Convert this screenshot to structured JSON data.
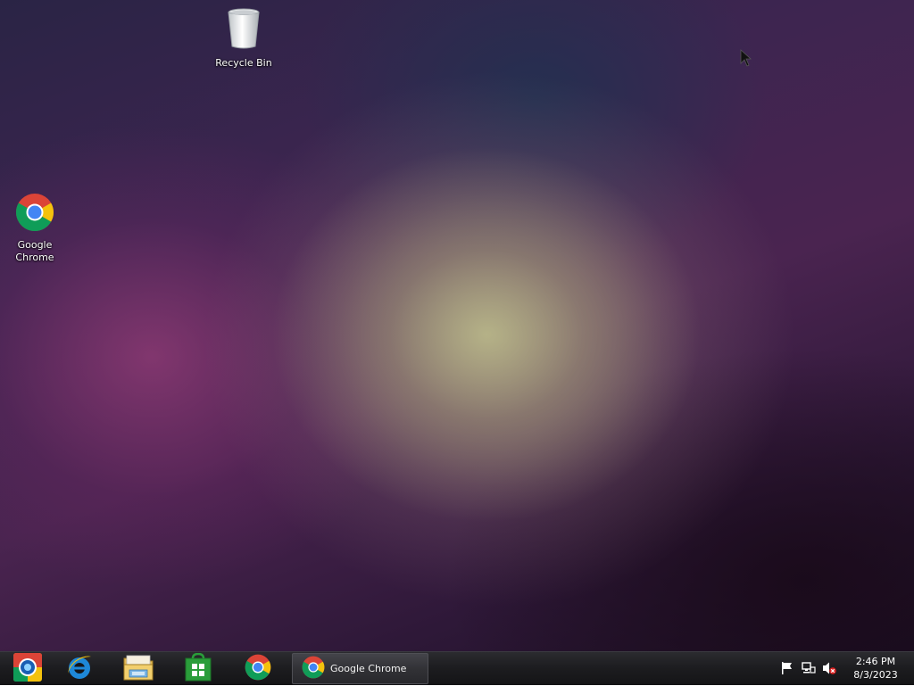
{
  "desktop": {
    "icons": [
      {
        "label": "Recycle Bin",
        "icon": "recycle-bin-icon"
      },
      {
        "label": "Google Chrome",
        "icon": "chrome-icon"
      }
    ]
  },
  "taskbar": {
    "pinned": [
      {
        "icon": "media-center-icon"
      },
      {
        "icon": "internet-explorer-icon"
      },
      {
        "icon": "file-explorer-icon"
      },
      {
        "icon": "store-icon"
      },
      {
        "icon": "chrome-icon"
      }
    ],
    "running_window": {
      "label": "Google Chrome",
      "icon": "chrome-icon"
    },
    "tray": {
      "icons": [
        "action-center-flag-icon",
        "network-icon",
        "volume-muted-icon"
      ],
      "time": "2:46 PM",
      "date": "8/3/2023"
    }
  },
  "colors": {
    "taskbar": "#1c1c1f",
    "chrome_red": "#db4437",
    "chrome_yellow": "#f4c20d",
    "chrome_green": "#0f9d58",
    "chrome_blue": "#4285f4",
    "store_green": "#2a9d3a",
    "ie_blue": "#1e88d8"
  }
}
